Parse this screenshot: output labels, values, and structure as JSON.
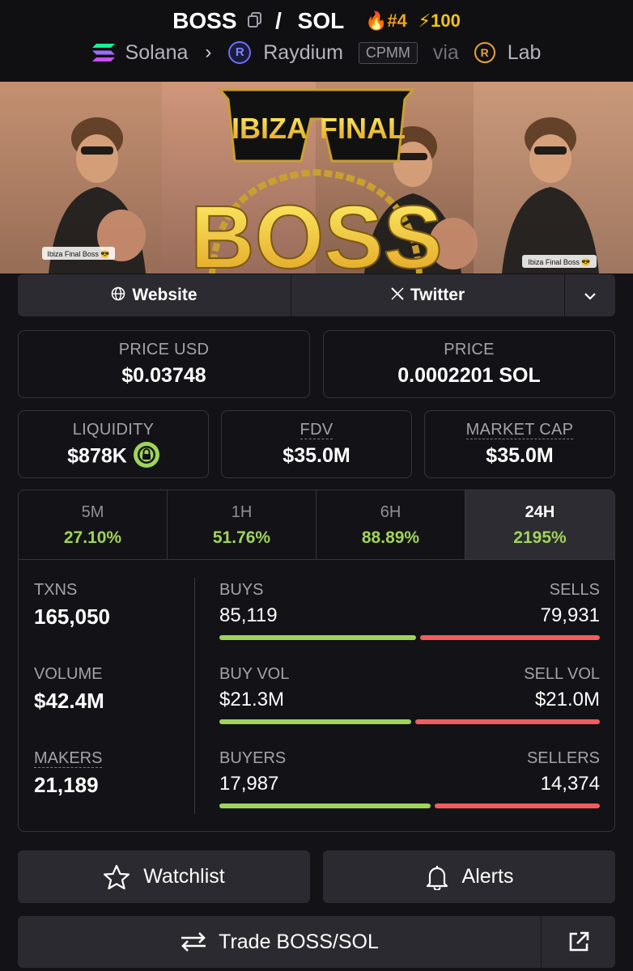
{
  "header": {
    "token_symbol": "BOSS",
    "separator": "/",
    "quote_symbol": "SOL",
    "rank": "#4",
    "boost": "100",
    "chain": "Solana",
    "dex": "Raydium",
    "dex_logo_letter": "R",
    "pool_type": "CPMM",
    "via": "via",
    "source": "Lab",
    "source_logo_letter": "R"
  },
  "banner": {
    "line1_left": "IBIZA",
    "line1_right": "FINAL",
    "big_word": "BOSS",
    "caption": "Ibiza Final Boss 😎"
  },
  "links": {
    "website": "Website",
    "twitter": "Twitter"
  },
  "prices": {
    "price_usd_label": "PRICE USD",
    "price_usd": "$0.03748",
    "price_label": "PRICE",
    "price_native": "0.0002201 SOL"
  },
  "market": {
    "liquidity_label": "LIQUIDITY",
    "liquidity": "$878K",
    "fdv_label": "FDV",
    "fdv": "$35.0M",
    "mcap_label": "MARKET CAP",
    "mcap": "$35.0M"
  },
  "tabs": [
    {
      "label": "5M",
      "value": "27.10%"
    },
    {
      "label": "1H",
      "value": "51.76%"
    },
    {
      "label": "6H",
      "value": "88.89%"
    },
    {
      "label": "24H",
      "value": "2195%"
    }
  ],
  "metrics": {
    "txns_label": "TXNS",
    "txns": "165,050",
    "volume_label": "VOLUME",
    "volume": "$42.4M",
    "makers_label": "MAKERS",
    "makers": "21,189",
    "buys_label": "BUYS",
    "buys": "85,119",
    "sells_label": "SELLS",
    "sells": "79,931",
    "buys_share": 0.516,
    "buy_vol_label": "BUY VOL",
    "buy_vol": "$21.3M",
    "sell_vol_label": "SELL VOL",
    "sell_vol": "$21.0M",
    "buy_vol_share": 0.504,
    "buyers_label": "BUYERS",
    "buyers": "17,987",
    "sellers_label": "SELLERS",
    "sellers": "14,374",
    "buyers_share": 0.556
  },
  "actions": {
    "watchlist": "Watchlist",
    "alerts": "Alerts",
    "trade": "Trade BOSS/SOL"
  },
  "colors": {
    "positive": "#9fd45b",
    "negative": "#f25c5c",
    "background": "#131317"
  }
}
